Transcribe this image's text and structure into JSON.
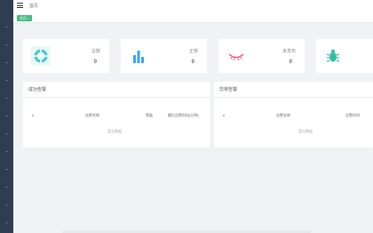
{
  "header": {
    "crumb": "首页"
  },
  "tags": {
    "active": "首页 ×"
  },
  "stats": [
    {
      "label": "总数",
      "value": "0",
      "icon": "pinwheel-icon",
      "color": "#40c9c6"
    },
    {
      "label": "正常",
      "value": "0",
      "icon": "bar-chart-icon",
      "color": "#36a3f7"
    },
    {
      "label": "未发布",
      "value": "0",
      "icon": "eye-closed-icon",
      "color": "#f4516c"
    },
    {
      "label": "",
      "value": "",
      "icon": "bug-icon",
      "color": "#34bfa3"
    }
  ],
  "panels": [
    {
      "title": "成功告警",
      "columns": [
        "#",
        "告警名称",
        "等级",
        "最后告警时间(分钟)"
      ],
      "empty": "暂无数据"
    },
    {
      "title": "异常告警",
      "columns": [
        "#",
        "告警名称",
        "告警时间"
      ],
      "empty": "暂无数据"
    }
  ]
}
